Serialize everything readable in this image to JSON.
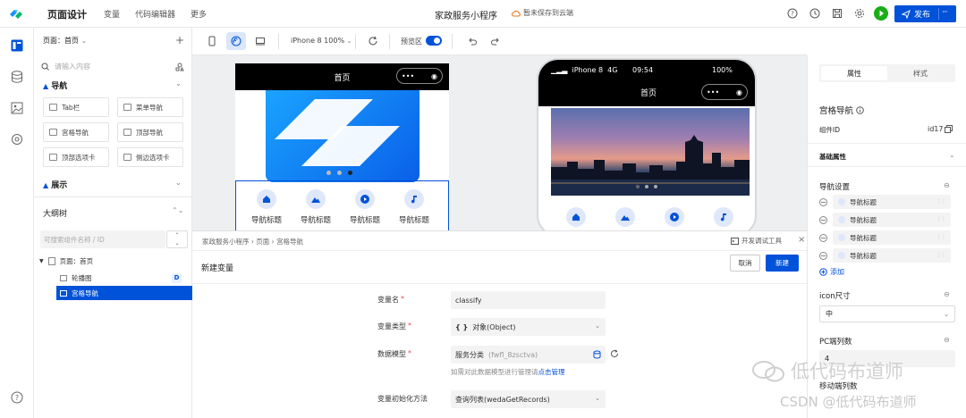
{
  "topbar": {
    "title": "页面设计",
    "menus": [
      "变量",
      "代码编辑器",
      "更多"
    ],
    "app_name": "家政服务小程序",
    "cloud_status": "暂未保存到云端",
    "publish_label": "发布",
    "more_label": "···"
  },
  "left_panel": {
    "page_selector": "页面：首页",
    "search_placeholder": "请输入内容",
    "nav_section": "导航",
    "components": [
      "Tab栏",
      "菜单导航",
      "宫格导航",
      "顶部导航",
      "顶部选项卡",
      "侧边选项卡"
    ],
    "display_section": "展示",
    "outline_title": "大纲树",
    "filter_placeholder": "可搜索组件名称 / ID",
    "tree": [
      {
        "label": "页面：首页"
      },
      {
        "label": "轮播图",
        "badge": "D"
      },
      {
        "label": "宫格导航",
        "selected": true
      }
    ]
  },
  "canvas_toolbar": {
    "device": "iPhone 8 100%",
    "preview_label": "预览区",
    "preview_on": true
  },
  "canvas": {
    "left_phone_title": "首页",
    "right_phone_status": {
      "carrier": "iPhone 8",
      "network": "4G",
      "time": "09:54",
      "battery": "100%"
    },
    "right_phone_title": "首页",
    "nav_items": [
      "导航标题",
      "导航标题",
      "导航标题",
      "导航标题"
    ],
    "nav_icons": [
      "home-icon",
      "landscape-icon",
      "play-icon",
      "music-icon"
    ]
  },
  "right_panel": {
    "tabs": [
      "属性",
      "样式"
    ],
    "active_tab": 0,
    "component_name": "宫格导航",
    "component_id_label": "组件ID",
    "component_id_value": "id17",
    "basic_props": "基础属性",
    "nav_settings": "导航设置",
    "nav_setting_items": [
      "导航标题",
      "导航标题",
      "导航标题",
      "导航标题"
    ],
    "add_label": "添加",
    "icon_size_label": "icon尺寸",
    "icon_size_value": "中",
    "pc_columns_label": "PC端列数",
    "pc_columns_value": "4",
    "mobile_columns_label": "移动端列数"
  },
  "dialog": {
    "breadcrumb": [
      "家政服务小程序",
      "页面",
      "宫格导航"
    ],
    "debug_tool": "开发调试工具",
    "title": "新建变量",
    "cancel_label": "取消",
    "create_label": "新建",
    "fields": [
      {
        "label": "变量名",
        "required": true,
        "value": "classify"
      },
      {
        "label": "变量类型",
        "required": true,
        "value": "对象(Object)",
        "prefix": "{ }"
      },
      {
        "label": "数据模型",
        "required": true,
        "value": "服务分类",
        "sub": "(fwfl_8zsctva)"
      },
      {
        "label": "变量初始化方法",
        "required": false,
        "value": "查询列表(wedaGetRecords)"
      }
    ],
    "hint_text": "如需对此数据模型进行管理请",
    "hint_link": "点击管理"
  },
  "watermark": {
    "line1": "低代码布道师",
    "line2": "CSDN @低代码布道师"
  },
  "colors": {
    "primary": "#0052d9",
    "run_green": "#1aad19",
    "canvas_bg": "#eeeff1"
  }
}
